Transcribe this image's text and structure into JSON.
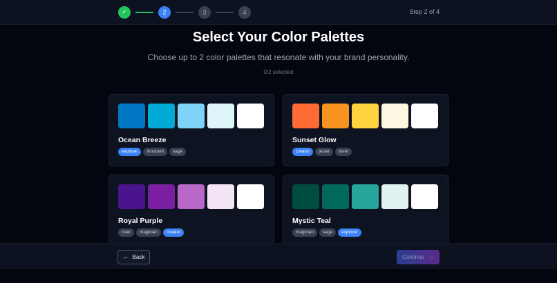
{
  "stepper": {
    "steps": [
      {
        "label": "✓",
        "state": "done"
      },
      {
        "label": "2",
        "state": "active"
      },
      {
        "label": "3",
        "state": "pending"
      },
      {
        "label": "4",
        "state": "pending"
      }
    ],
    "status": "Step 2 of 4"
  },
  "header": {
    "title": "Select Your Color Palettes",
    "subtitle": "Choose up to 2 color palettes that resonate with your brand personality.",
    "selected": "0/2 selected"
  },
  "palettes": [
    {
      "name": "Ocean Breeze",
      "colors": [
        "#0077c2",
        "#00aad4",
        "#7fd3f8",
        "#def6f9",
        "#ffffff"
      ],
      "tags": [
        {
          "label": "explorer",
          "highlight": true
        },
        {
          "label": "innocent",
          "highlight": false
        },
        {
          "label": "sage",
          "highlight": false
        }
      ]
    },
    {
      "name": "Sunset Glow",
      "colors": [
        "#ff6b35",
        "#f7931e",
        "#ffd23f",
        "#fdf6e1",
        "#ffffff"
      ],
      "tags": [
        {
          "label": "creator",
          "highlight": true
        },
        {
          "label": "jester",
          "highlight": false
        },
        {
          "label": "lover",
          "highlight": false
        }
      ]
    },
    {
      "name": "Royal Purple",
      "colors": [
        "#4a148c",
        "#7b1fa2",
        "#ba68c8",
        "#f3e5f5",
        "#ffffff"
      ],
      "tags": [
        {
          "label": "ruler",
          "highlight": false
        },
        {
          "label": "magician",
          "highlight": false
        },
        {
          "label": "creator",
          "highlight": true
        }
      ]
    },
    {
      "name": "Mystic Teal",
      "colors": [
        "#004d40",
        "#00695c",
        "#26a69a",
        "#e0f2f1",
        "#ffffff"
      ],
      "tags": [
        {
          "label": "magician",
          "highlight": false
        },
        {
          "label": "sage",
          "highlight": false
        },
        {
          "label": "explorer",
          "highlight": true
        }
      ]
    }
  ],
  "footer": {
    "back_label": "Back",
    "continue_label": "Continue",
    "back_icon": "arrow-left-icon",
    "continue_icon": "arrow-right-icon"
  }
}
